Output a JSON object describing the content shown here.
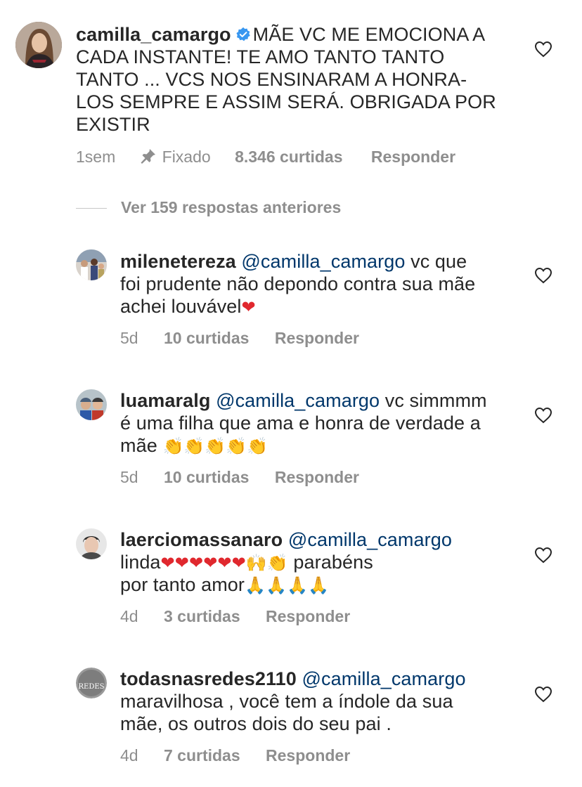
{
  "comments": [
    {
      "username": "camilla_camargo",
      "verified": true,
      "text": "MÃE VC ME EMOCIONA A CADA INSTANTE! TE AMO TANTO TANTO TANTO ... VCS NOS ENSINARAM A HONRA-LOS SEMPRE E ASSIM SERÁ. OBRIGADA POR EXISTIR",
      "lines": [
        "MÃE VC ME EMOCIONA A",
        "CADA INSTANTE! TE AMO TANTO TANTO",
        "TANTO ... VCS NOS ENSINARAM A HONRA-",
        "LOS SEMPRE E ASSIM SERÁ. OBRIGADA POR",
        "EXISTIR"
      ],
      "time": "1sem",
      "pinned_label": "Fixado",
      "likes": "8.346 curtidas",
      "reply": "Responder"
    }
  ],
  "view_replies": "Ver 159 respostas anteriores",
  "replies": [
    {
      "username": "milenetereza",
      "mention": "@camilla_camargo",
      "line1_after": " vc que",
      "line2": "foi prudente não depondo contra sua mãe",
      "line3": "achei louvável",
      "time": "5d",
      "likes": "10 curtidas",
      "reply": "Responder"
    },
    {
      "username": "luamaralg",
      "mention": "@camilla_camargo",
      "line1_after": " vc simmmm",
      "line2": "é uma filha que ama e honra de verdade a",
      "line3": "mãe",
      "time": "5d",
      "likes": "10 curtidas",
      "reply": "Responder"
    },
    {
      "username": "laerciomassanaro",
      "mention": "@camilla_camargo",
      "line2": "linda",
      "line2_after": " parabéns",
      "line3": "por tanto amor",
      "time": "4d",
      "likes": "3 curtidas",
      "reply": "Responder"
    },
    {
      "username": "todasnasredes2110",
      "mention": "@camilla_camargo",
      "line2": "maravilhosa , você  tem a índole da sua",
      "line3": "mãe, os outros dois do seu pai .",
      "avatar_text": "REDES",
      "time": "4d",
      "likes": "7 curtidas",
      "reply": "Responder"
    }
  ],
  "icons": {
    "heart": "heart-outline-icon",
    "pin": "pin-icon",
    "verified": "verified-badge-icon"
  },
  "colors": {
    "username": "#262626",
    "mention": "#00376b",
    "meta": "#8e8e8e",
    "verified": "#3897f0"
  }
}
